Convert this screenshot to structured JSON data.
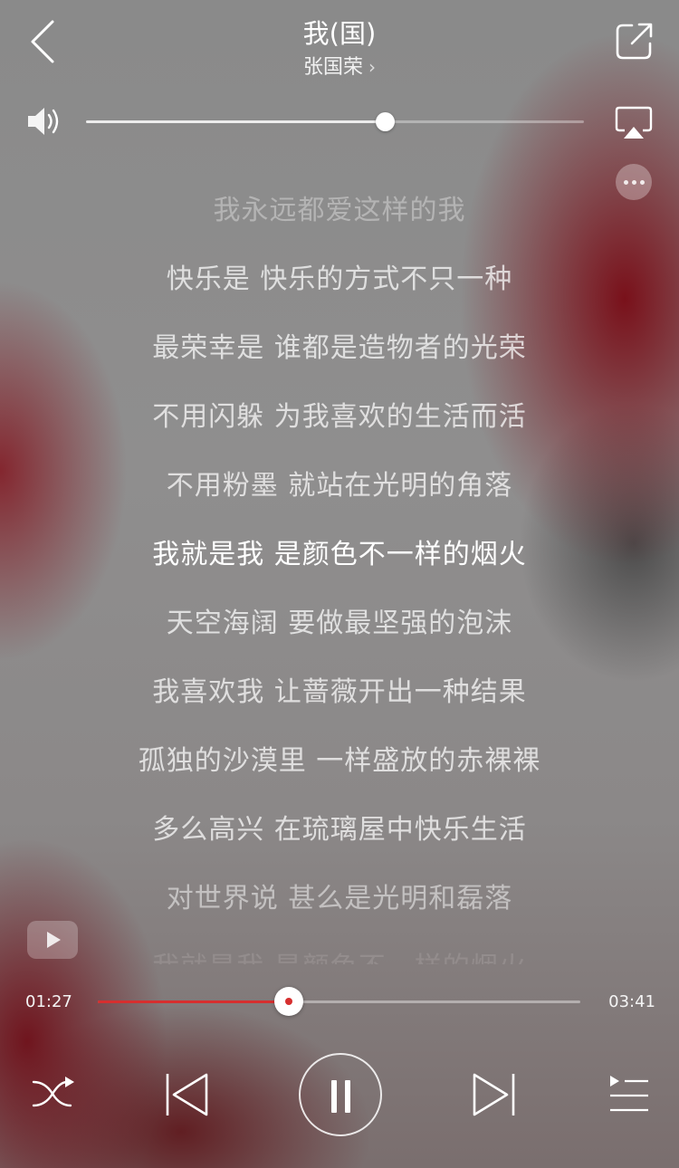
{
  "header": {
    "song_title": "我(国)",
    "artist": "张国荣",
    "artist_chevron": "›"
  },
  "volume": {
    "level": 0.6
  },
  "lyrics": {
    "current_index": 5,
    "lines": [
      "我永远都爱这样的我",
      "快乐是 快乐的方式不只一种",
      "最荣幸是 谁都是造物者的光荣",
      "不用闪躲 为我喜欢的生活而活",
      "不用粉墨 就站在光明的角落",
      "我就是我 是颜色不一样的烟火",
      "天空海阔 要做最坚强的泡沫",
      "我喜欢我 让蔷薇开出一种结果",
      "孤独的沙漠里 一样盛放的赤裸裸",
      "多么高兴 在琉璃屋中快乐生活",
      "对世界说 甚么是光明和磊落",
      "我就是我 是颜色不一样的烟火"
    ]
  },
  "playback": {
    "current_time": "01:27",
    "duration": "03:41",
    "progress": 0.395,
    "state": "playing"
  },
  "icons": {
    "back": "chevron-left-icon",
    "share": "share-icon",
    "volume": "speaker-icon",
    "airplay": "airplay-icon",
    "more": "more-icon",
    "video": "video-play-icon",
    "shuffle": "shuffle-icon",
    "previous": "skip-previous-icon",
    "pause": "pause-icon",
    "next": "skip-next-icon",
    "playlist": "playlist-icon"
  },
  "colors": {
    "accent": "#d62f2f",
    "text": "#ffffff"
  }
}
